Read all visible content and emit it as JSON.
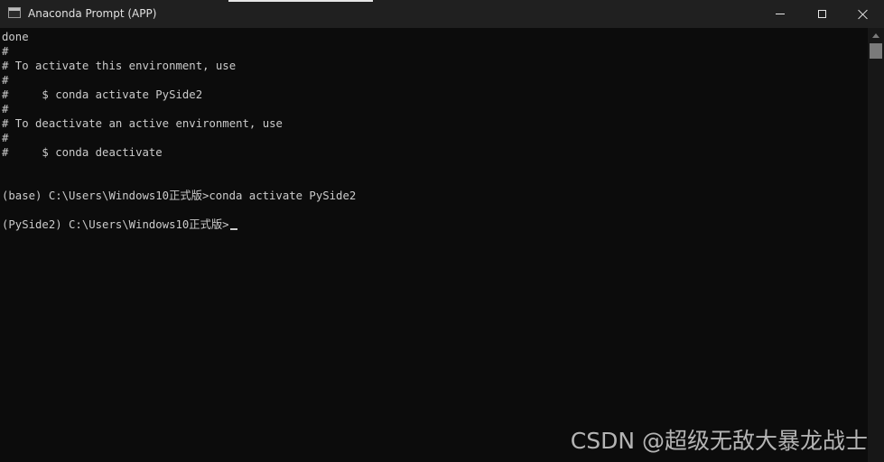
{
  "window": {
    "title": "Anaconda Prompt (APP)",
    "colors": {
      "titlebar": "#202020",
      "console_bg": "#0c0c0c",
      "console_text": "#cccccc"
    }
  },
  "titlebar": {
    "app_icon": "console-window-icon",
    "minimize_icon": "minimize-icon",
    "maximize_icon": "maximize-icon",
    "close_icon": "close-icon"
  },
  "console": {
    "lines": [
      "done",
      "#",
      "# To activate this environment, use",
      "#",
      "#     $ conda activate PySide2",
      "#",
      "# To deactivate an active environment, use",
      "#",
      "#     $ conda deactivate",
      "",
      "",
      "(base) C:\\Users\\Windows10正式版>conda activate PySide2",
      "",
      "(PySide2) C:\\Users\\Windows10正式版>"
    ]
  },
  "scrollbar": {
    "up_icon": "scroll-up-arrow-icon"
  },
  "watermark": {
    "text": "CSDN @超级无敌大暴龙战士"
  }
}
